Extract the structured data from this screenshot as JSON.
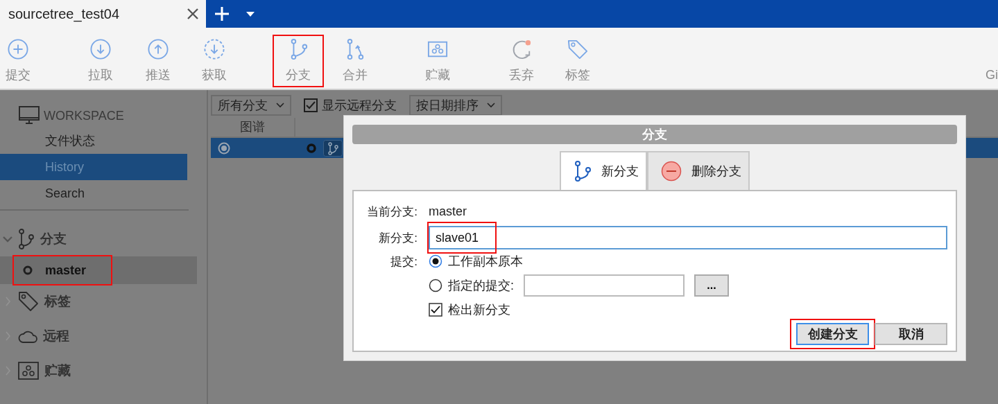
{
  "tab": {
    "title": "sourcetree_test04"
  },
  "toolbar": {
    "items": [
      {
        "kind": "commit",
        "label": "提交",
        "highlighted": false
      },
      {
        "kind": "pull",
        "label": "拉取",
        "highlighted": false
      },
      {
        "kind": "push",
        "label": "推送",
        "highlighted": false
      },
      {
        "kind": "fetch",
        "label": "获取",
        "highlighted": false
      },
      {
        "kind": "branch",
        "label": "分支",
        "highlighted": true
      },
      {
        "kind": "merge",
        "label": "合并",
        "highlighted": false
      },
      {
        "kind": "stash",
        "label": "贮藏",
        "highlighted": false
      },
      {
        "kind": "discard",
        "label": "丢弃",
        "highlighted": false
      },
      {
        "kind": "tag",
        "label": "标签",
        "highlighted": false
      }
    ],
    "overflow_label": "Gi"
  },
  "sidebar": {
    "workspace": {
      "title": "WORKSPACE",
      "items": [
        {
          "label": "文件状态",
          "selected": false
        },
        {
          "label": "History",
          "selected": true
        },
        {
          "label": "Search",
          "selected": false
        }
      ]
    },
    "sections": [
      {
        "kind": "branch",
        "label": "分支",
        "expanded": true,
        "children": [
          {
            "label": "master",
            "current": true,
            "highlighted": true
          }
        ]
      },
      {
        "kind": "tag",
        "label": "标签",
        "expanded": false
      },
      {
        "kind": "remote",
        "label": "远程",
        "expanded": false
      },
      {
        "kind": "stash",
        "label": "贮藏",
        "expanded": false
      }
    ]
  },
  "filter_bar": {
    "branch_filter": "所有分支",
    "show_remote": {
      "label": "显示远程分支",
      "checked": true
    },
    "sort": "按日期排序"
  },
  "table": {
    "columns": [
      "图谱"
    ],
    "rows": [
      {
        "selected": true
      }
    ]
  },
  "dialog": {
    "title": "分支",
    "tabs": [
      {
        "kind": "new",
        "label": "新分支",
        "selected": true
      },
      {
        "kind": "delete",
        "label": "删除分支",
        "selected": false
      }
    ],
    "current_branch": {
      "label": "当前分支:",
      "value": "master"
    },
    "new_branch": {
      "label": "新分支:",
      "value": "slave01",
      "highlighted": true
    },
    "commit": {
      "label": "提交:",
      "options": [
        {
          "label": "工作副本原本",
          "selected": true
        },
        {
          "label": "指定的提交:",
          "selected": false
        }
      ],
      "browse": "..."
    },
    "checkout": {
      "label": "检出新分支",
      "checked": true
    },
    "buttons": [
      {
        "label": "创建分支",
        "default": true,
        "highlighted": true
      },
      {
        "label": "取消",
        "default": false,
        "highlighted": false
      }
    ]
  }
}
